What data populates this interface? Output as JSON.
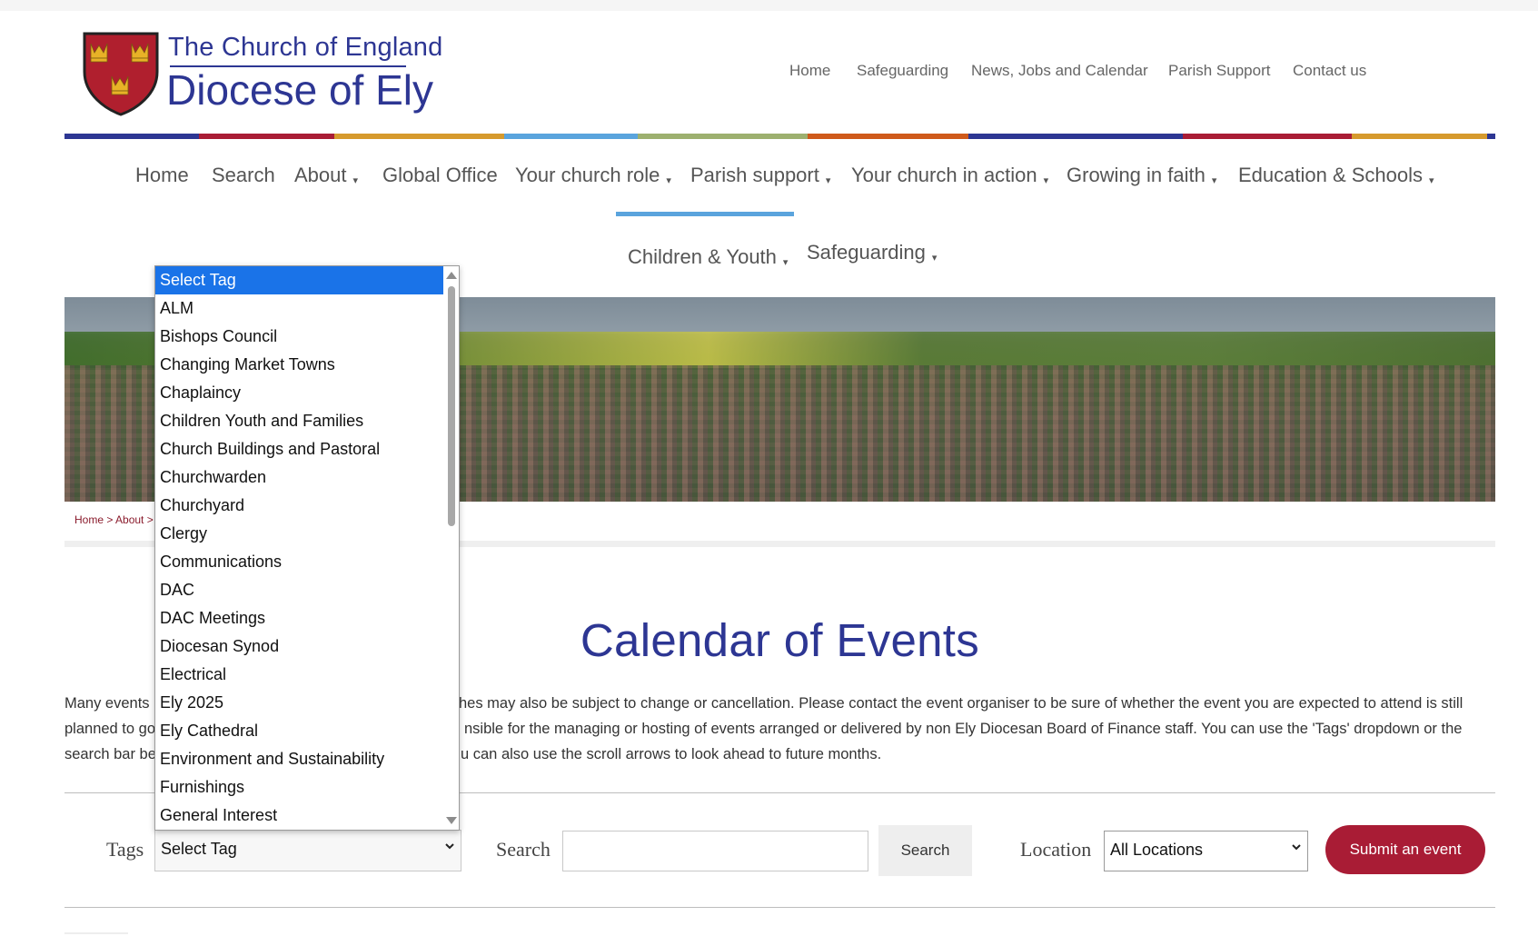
{
  "logo": {
    "line1": "The Church of England",
    "line2": "Diocese of Ely"
  },
  "top_nav": [
    {
      "label": "Home"
    },
    {
      "label": "Safeguarding"
    },
    {
      "label": "News, Jobs and Calendar"
    },
    {
      "label": "Parish Support"
    },
    {
      "label": "Contact us"
    }
  ],
  "stripe_colors": [
    "#2d3693",
    "#a91c35",
    "#d69a2d",
    "#5aa4dd",
    "#9db06f",
    "#cf5a1a",
    "#2d3693",
    "#a91c35",
    "#d69a2d",
    "#2d3693"
  ],
  "main_nav": [
    {
      "label": "Home",
      "caret": ""
    },
    {
      "label": "Search",
      "caret": ""
    },
    {
      "label": "About",
      "caret": "▾"
    },
    {
      "label": "Global Office",
      "caret": ""
    },
    {
      "label": "Your church role",
      "caret": "▾"
    },
    {
      "label": "Parish support",
      "caret": "▾"
    },
    {
      "label": "Your church in action",
      "caret": "▾"
    },
    {
      "label": "Growing in faith",
      "caret": "▾"
    },
    {
      "label": "Education & Schools",
      "caret": "▾"
    }
  ],
  "main_nav_row2": [
    {
      "label": "Children & Youth",
      "caret": "▾"
    },
    {
      "label": "Safeguarding",
      "caret": "▾"
    }
  ],
  "breadcrumb": {
    "home": "Home",
    "sep1": " > ",
    "about": "About",
    "sep2": " > "
  },
  "page_title": "Calendar of Events",
  "intro": {
    "line1_start": "Many events",
    "line1_end": "hes may also be subject to change or cancellation. Please contact the event organiser to be sure of whether the event you are expected to attend is still",
    "line2_start": "planned to go",
    "line2_end": "nsible for the managing or hosting of events arranged or delivered by non Ely Diocesan Board of Finance staff. You can use the 'Tags' dropdown or the",
    "line3_start": "search bar be",
    "line3_end": "u can also use the scroll arrows to look ahead to future months."
  },
  "filters": {
    "tags_label": "Tags",
    "tags_value": "Select Tag",
    "search_label": "Search",
    "search_value": "",
    "search_button": "Search",
    "location_label": "Location",
    "location_value": "All Locations",
    "submit_button": "Submit an event"
  },
  "tag_options": [
    "Select Tag",
    "ALM",
    "Bishops Council",
    "Changing Market Towns",
    "Chaplaincy",
    "Children Youth and Families",
    "Church Buildings and Pastoral",
    "Churchwarden",
    "Churchyard",
    "Clergy",
    "Communications",
    "DAC",
    "DAC Meetings",
    "Diocesan Synod",
    "Electrical",
    "Ely 2025",
    "Ely Cathedral",
    "Environment and Sustainability",
    "Furnishings",
    "General Interest"
  ],
  "selected_tag_index": 0
}
